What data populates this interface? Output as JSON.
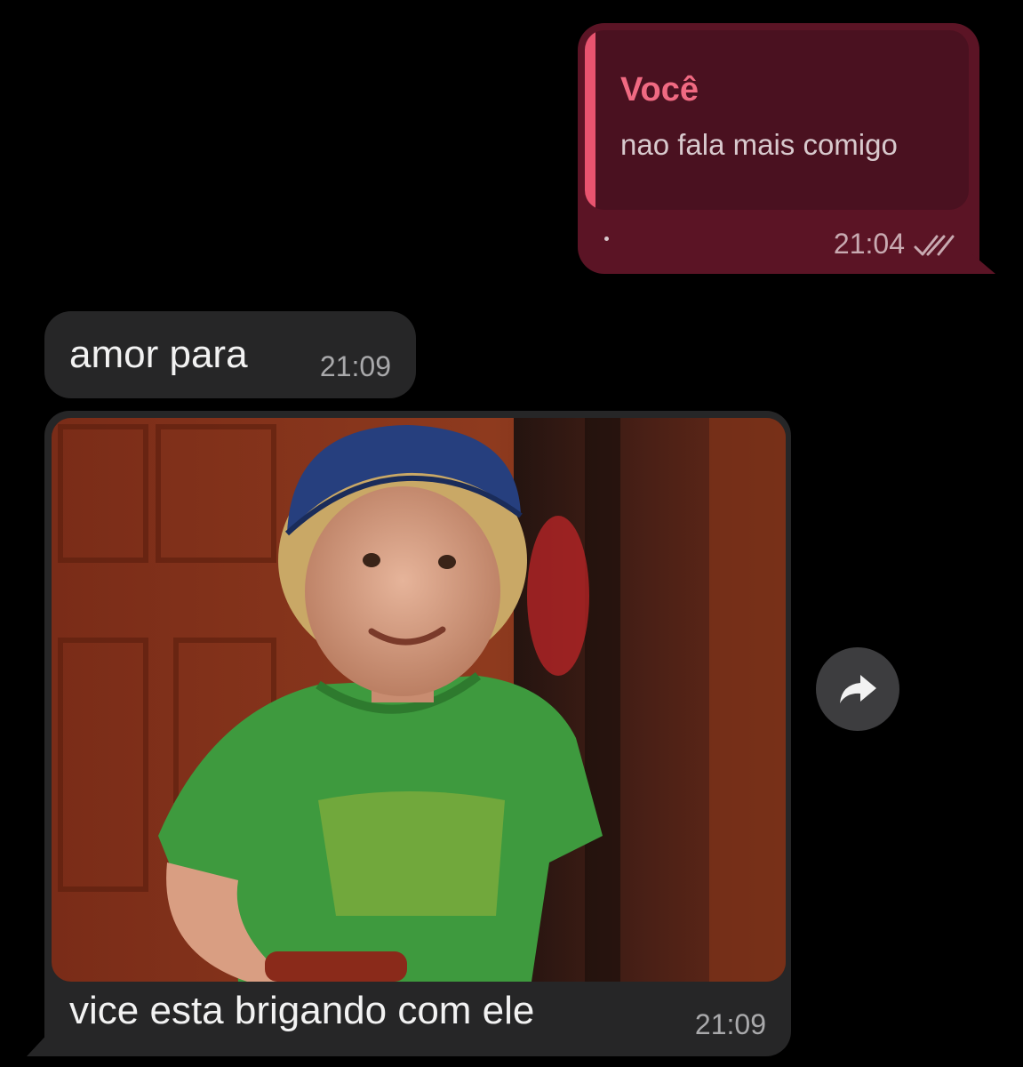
{
  "outgoing": {
    "quote_author": "Você",
    "quote_text": "nao fala mais comigo",
    "time": "21:04",
    "status_icon": "double-check-icon"
  },
  "incoming_text": {
    "text": "amor para",
    "time": "21:09"
  },
  "incoming_photo": {
    "caption": "vice esta brigando com ele",
    "time": "21:09"
  },
  "actions": {
    "forward_icon": "forward-icon"
  },
  "colors": {
    "background": "#000000",
    "outgoing_bubble": "#5b1425",
    "quote_accent": "#e8546f",
    "incoming_bubble": "#262627"
  }
}
